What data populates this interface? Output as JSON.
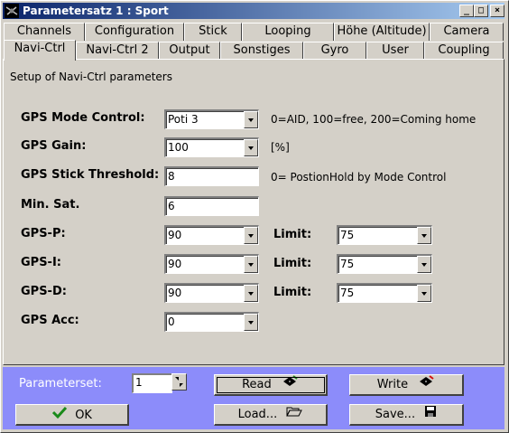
{
  "window": {
    "title": "Parametersatz 1 : Sport",
    "minimize": "_",
    "maximize": "□",
    "close": "×"
  },
  "tabs_row1": [
    {
      "label": "Channels"
    },
    {
      "label": "Configuration"
    },
    {
      "label": "Stick"
    },
    {
      "label": "Looping"
    },
    {
      "label": "Höhe (Altitude)"
    },
    {
      "label": "Camera"
    }
  ],
  "tabs_row2": [
    {
      "label": "Navi-Ctrl",
      "active": true
    },
    {
      "label": "Navi-Ctrl 2"
    },
    {
      "label": "Output"
    },
    {
      "label": "Sonstiges"
    },
    {
      "label": "Gyro"
    },
    {
      "label": "User"
    },
    {
      "label": "Coupling"
    }
  ],
  "panel": {
    "description": "Setup of Navi-Ctrl parameters",
    "fields": {
      "gps_mode_control": {
        "label": "GPS Mode Control:",
        "value": "Poti 3",
        "note": "0=AID, 100=free, 200=Coming home"
      },
      "gps_gain": {
        "label": "GPS Gain:",
        "value": "100",
        "note": "[%]"
      },
      "gps_stick_threshold": {
        "label": "GPS Stick Threshold:",
        "value": "8",
        "note": "0= PostionHold by Mode Control"
      },
      "min_sat": {
        "label": "Min. Sat.",
        "value": "6"
      },
      "gps_p": {
        "label": "GPS-P:",
        "value": "90",
        "limit_label": "Limit:",
        "limit_value": "75"
      },
      "gps_i": {
        "label": "GPS-I:",
        "value": "90",
        "limit_label": "Limit:",
        "limit_value": "75"
      },
      "gps_d": {
        "label": "GPS-D:",
        "value": "90",
        "limit_label": "Limit:",
        "limit_value": "75"
      },
      "gps_acc": {
        "label": "GPS Acc:",
        "value": "0"
      }
    }
  },
  "bottom": {
    "parameterset_label": "Parameterset:",
    "parameterset_value": "1",
    "read_label": "Read",
    "write_label": "Write",
    "ok_label": "OK",
    "load_label": "Load...",
    "save_label": "Save...",
    "bar_color": "#8c8cfa"
  },
  "icons": {
    "app": "helicopter-icon",
    "ok": "checkmark-icon",
    "read": "chip-read-icon",
    "write": "chip-write-icon",
    "load": "folder-open-icon",
    "save": "floppy-disk-icon"
  }
}
